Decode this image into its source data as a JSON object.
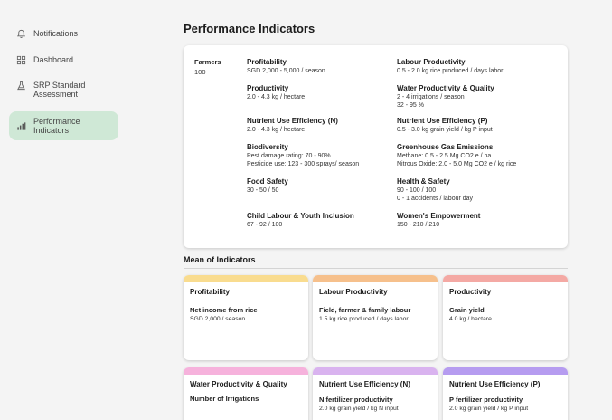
{
  "sidebar": {
    "items": [
      {
        "label": "Notifications",
        "icon": "bell-icon"
      },
      {
        "label": "Dashboard",
        "icon": "dashboard-icon"
      },
      {
        "label": "SRP Standard Assessment",
        "icon": "flask-icon"
      },
      {
        "label": "Performance Indicators",
        "icon": "bar-chart-icon",
        "active": true
      }
    ]
  },
  "main": {
    "title": "Performance Indicators",
    "farmers": {
      "label": "Farmers",
      "value": "100"
    },
    "indicators": [
      {
        "title": "Profitability",
        "lines": [
          "SGD 2,000 - 5,000 / season"
        ]
      },
      {
        "title": "Labour Productivity",
        "lines": [
          "0.5 - 2.0 kg rice produced / days labor"
        ]
      },
      {
        "title": "Productivity",
        "lines": [
          "2.0 - 4.3 kg / hectare"
        ]
      },
      {
        "title": "Water Productivity & Quality",
        "lines": [
          "2 - 4 irrigations / season",
          "32 - 95 %"
        ]
      },
      {
        "title": "Nutrient Use Efficiency (N)",
        "lines": [
          "2.0 - 4.3 kg / hectare"
        ]
      },
      {
        "title": "Nutrient Use Efficiency (P)",
        "lines": [
          "0.5 - 3.0 kg grain yield / kg P input"
        ]
      },
      {
        "title": "Biodiversity",
        "lines": [
          "Pest damage rating: 70 - 90%",
          "Pesticide use: 123 - 300 sprays/ season"
        ]
      },
      {
        "title": "Greenhouse Gas Emissions",
        "lines": [
          "Methane: 0.5 - 2.5 Mg CO2 e / ha",
          "Nitrous Oxide: 2.0 - 5.0 Mg CO2 e / kg rice"
        ]
      },
      {
        "title": "Food Safety",
        "lines": [
          "30 - 50 / 50"
        ]
      },
      {
        "title": "Health & Safety",
        "lines": [
          "90 - 100 / 100",
          "0 - 1 accidents / labour day"
        ]
      },
      {
        "title": "Child Labour & Youth Inclusion",
        "lines": [
          "67 - 92 / 100"
        ]
      },
      {
        "title": "Women's Empowerment",
        "lines": [
          "150 - 210 / 210"
        ]
      }
    ],
    "mean_section_title": "Mean of Indicators",
    "mean_cards": [
      {
        "title": "Profitability",
        "subtitle": "Net income from rice",
        "value": "SGD 2,000 / season",
        "color": "#f9dc8f"
      },
      {
        "title": "Labour Productivity",
        "subtitle": "Field, farmer & family labour",
        "value": "1.5 kg rice produced / days labor",
        "color": "#f6c08c"
      },
      {
        "title": "Productivity",
        "subtitle": "Grain yield",
        "value": "4.0 kg / hectare",
        "color": "#f4a9a4"
      },
      {
        "title": "Water Productivity & Quality",
        "subtitle": "Number of Irrigations",
        "value": "",
        "color": "#f6b2dc"
      },
      {
        "title": "Nutrient Use Efficiency (N)",
        "subtitle": "N fertilizer productivity",
        "value": "2.0 kg grain yield / kg N input",
        "color": "#d9b3ef"
      },
      {
        "title": "Nutrient Use Efficiency (P)",
        "subtitle": "P fertilizer productivity",
        "value": "2.0 kg grain yield / kg P input",
        "color": "#b69cf0"
      }
    ]
  }
}
